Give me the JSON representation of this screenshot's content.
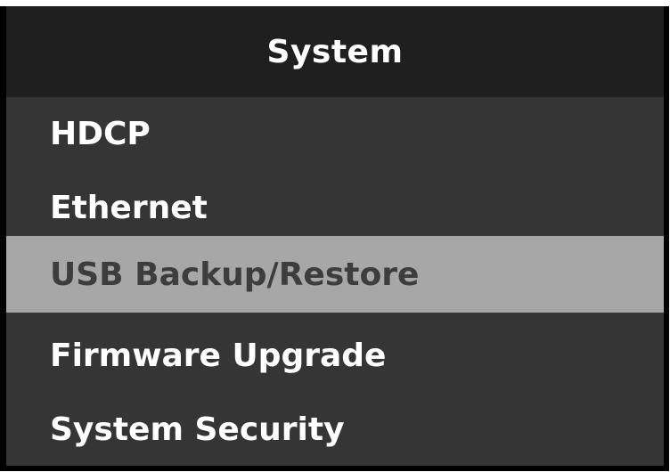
{
  "header": {
    "title": "System"
  },
  "menu": {
    "selected_index": 2,
    "items": [
      {
        "label": "HDCP"
      },
      {
        "label": "Ethernet"
      },
      {
        "label": "USB Backup/Restore"
      },
      {
        "label": "Firmware Upgrade"
      },
      {
        "label": "System Security"
      }
    ]
  },
  "colors": {
    "frame": "#000000",
    "title_bar": "#1f1f1f",
    "menu_background": "#353535",
    "selected_background": "#a7a7a7",
    "text": "#ffffff",
    "selected_text": "#3d3d3d"
  }
}
